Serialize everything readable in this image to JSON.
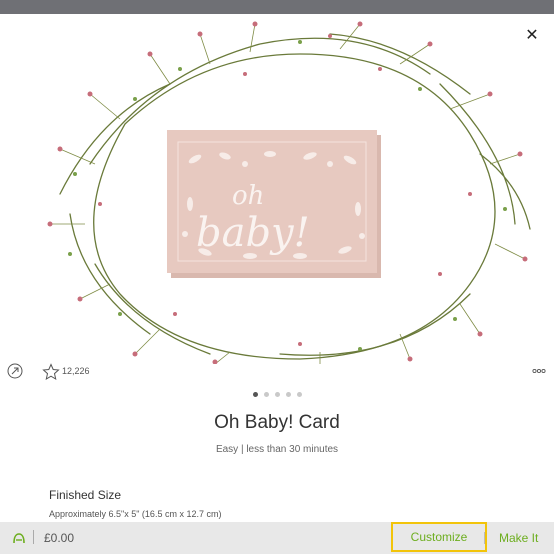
{
  "project": {
    "title": "Oh Baby! Card",
    "subtitle": "Easy | less than 30 minutes",
    "favorites_count": "12,226",
    "card_text_line1": "oh",
    "card_text_line2": "baby!"
  },
  "carousel": {
    "dot_count": 5,
    "active_index": 0
  },
  "details": {
    "finished_size_label": "Finished Size",
    "finished_size_value": "Approximately 6.5\"x 5\" (16.5 cm x 12.7 cm)"
  },
  "bottom_bar": {
    "price": "£0.00",
    "customize_label": "Customize",
    "make_it_label": "Make It"
  },
  "icons": {
    "close": "close-icon",
    "share": "share-icon",
    "favorite": "star-icon",
    "more": "more-icon",
    "brand": "cricut-access-icon"
  },
  "colors": {
    "accent_green": "#6dae1f",
    "highlight_yellow": "#f2c40a",
    "card_pink": "#e7c9c0"
  }
}
